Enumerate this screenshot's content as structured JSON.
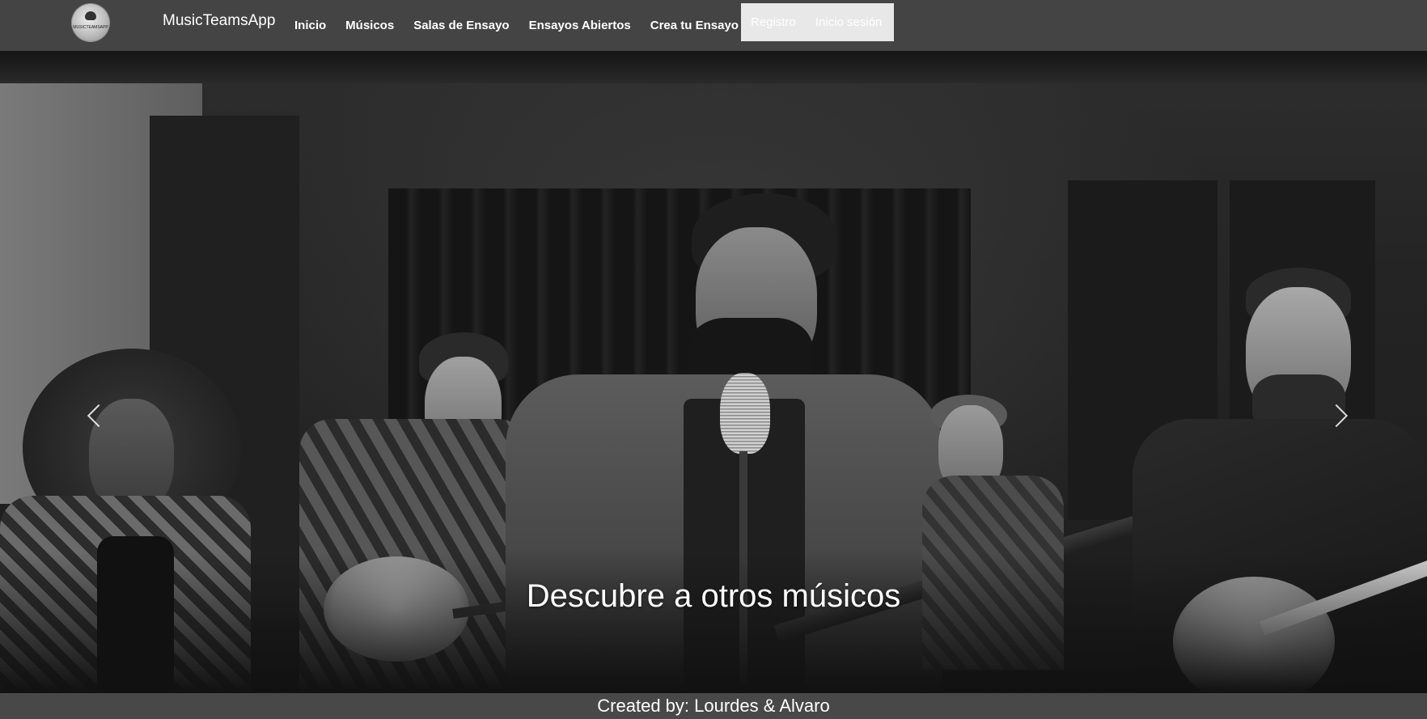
{
  "header": {
    "logo_text": "MUSICTEAMSAPP",
    "brand": "MusicTeamsApp",
    "nav": [
      {
        "label": "Inicio"
      },
      {
        "label": "Músicos"
      },
      {
        "label": "Salas de Ensayo"
      },
      {
        "label": "Ensayos Abiertos"
      },
      {
        "label": "Crea tu Ensayo"
      }
    ],
    "auth": {
      "register": "Registro",
      "login": "Inicio sesión"
    }
  },
  "hero": {
    "caption": "Descubre a otros músicos",
    "prev_icon": "chevron-left-icon",
    "next_icon": "chevron-right-icon"
  },
  "footer": {
    "text": "Created by: Lourdes & Alvaro"
  },
  "colors": {
    "navbar_bg": "#444444",
    "auth_box_bg": "#e8e8e8",
    "footer_bg": "#484848",
    "text": "#ffffff"
  }
}
